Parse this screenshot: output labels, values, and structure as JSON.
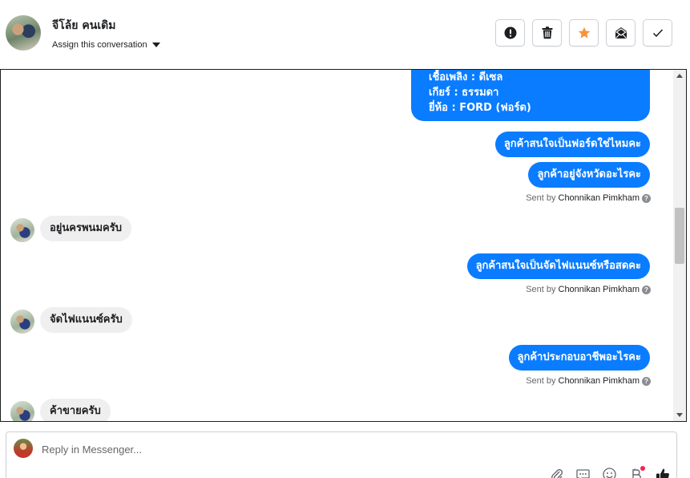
{
  "header": {
    "contact_name": "จีโล้ย คนเดิม",
    "assign_label": "Assign this conversation",
    "actions": [
      {
        "name": "mark-spam",
        "icon": "exclamation-circle-icon"
      },
      {
        "name": "delete",
        "icon": "trash-icon"
      },
      {
        "name": "star",
        "icon": "star-icon",
        "color": "#f7923a"
      },
      {
        "name": "mark-unread",
        "icon": "envelope-icon"
      },
      {
        "name": "done",
        "icon": "check-icon"
      }
    ]
  },
  "conversation": {
    "info_bubble_lines": [
      "เชื้อเพลิง : ดีเซล",
      "เกียร์ : ธรรมดา",
      "ยี่ห้อ : FORD (ฟอร์ด)"
    ],
    "messages": [
      {
        "dir": "out",
        "text": "ลูกค้าสนใจเป็นฟอร์ดใช่ไหมคะ"
      },
      {
        "dir": "out",
        "text": "ลูกค้าอยู่จังหวัดอะไรคะ"
      },
      {
        "dir": "sent",
        "prefix": "Sent by",
        "author": "Chonnikan Pimkham"
      },
      {
        "dir": "in",
        "text": "อยู่นครพนมครับ"
      },
      {
        "dir": "out",
        "text": "ลูกค้าสนใจเป็นจัดไฟแนนซ์หรือสดคะ"
      },
      {
        "dir": "sent",
        "prefix": "Sent by",
        "author": "Chonnikan Pimkham"
      },
      {
        "dir": "in",
        "text": "จัดไฟแนนซ์ครับ"
      },
      {
        "dir": "out",
        "text": "ลูกค้าประกอบอาชีพอะไรคะ"
      },
      {
        "dir": "sent",
        "prefix": "Sent by",
        "author": "Chonnikan Pimkham"
      },
      {
        "dir": "in",
        "text": "ค้าขายครับ"
      }
    ],
    "outgoing_color": "#0a7cff",
    "incoming_color": "#efefef"
  },
  "composer": {
    "placeholder": "Reply in Messenger...",
    "tools": [
      "paperclip-icon",
      "saved-replies-icon",
      "emoji-icon",
      "bold-icon",
      "like-icon"
    ]
  }
}
